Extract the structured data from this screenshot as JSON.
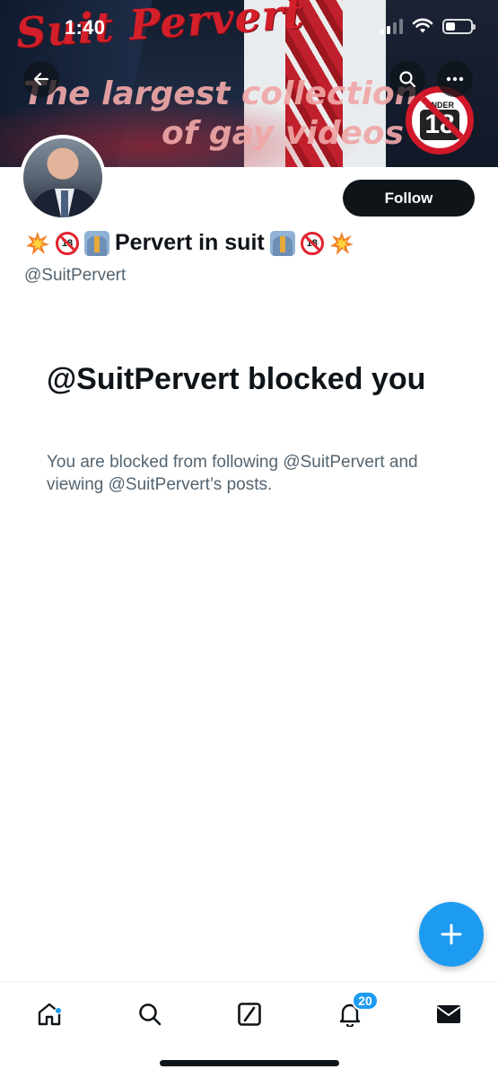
{
  "status_bar": {
    "time": "1:40"
  },
  "banner": {
    "brand": "Suit Pervert",
    "tagline_line1": "The largest collection",
    "tagline_line2": "of gay videos",
    "under18_label": "UNDER",
    "under18_number": "18"
  },
  "profile": {
    "display_name": "Pervert in suit",
    "name_emojis": [
      "collision",
      "no-one-under-eighteen",
      "man-in-suit"
    ],
    "handle": "@SuitPervert",
    "follow_label": "Follow"
  },
  "blocked": {
    "title": "@SuitPervert blocked you",
    "body": "You are blocked from following @SuitPervert and viewing @SuitPervert’s posts."
  },
  "bottom_nav": {
    "items": [
      "home",
      "search",
      "grok",
      "notifications",
      "messages"
    ],
    "notifications_count": "20"
  },
  "colors": {
    "accent": "#1d9bf0",
    "text_primary": "#0f1419",
    "text_secondary": "#536471",
    "brand_red": "#d31f2a"
  }
}
